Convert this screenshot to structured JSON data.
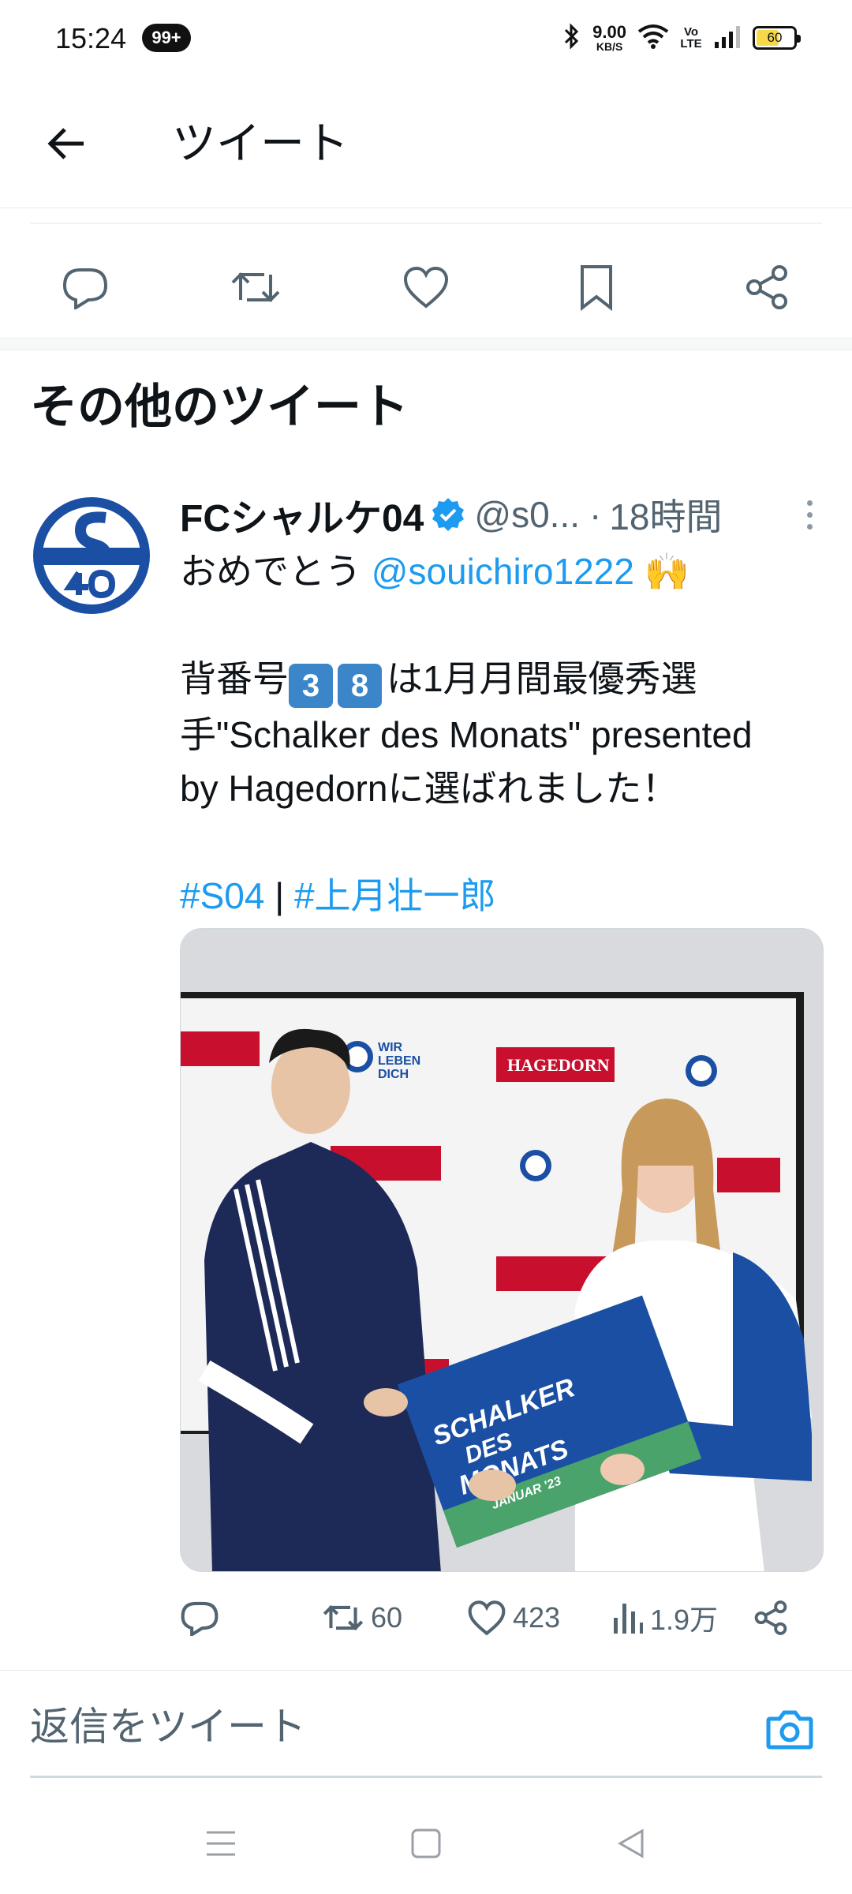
{
  "status_bar": {
    "time": "15:24",
    "notification_badge": "99+",
    "net_speed_value": "9.00",
    "net_speed_unit": "KB/S",
    "volte": "Vo LTE",
    "battery": "60",
    "battery_level": 0.6
  },
  "header": {
    "title": "ツイート"
  },
  "section": {
    "title": "その他のツイート"
  },
  "tweet": {
    "author": "FCシャルケ04",
    "handle": "@s0...",
    "separator": "·",
    "time": "18時間",
    "line1_prefix": "おめでとう ",
    "line1_mention": "@souichiro1222",
    "line1_emoji": "🙌",
    "line2_prefix": "背番号",
    "keycap1": "3",
    "keycap2": "8",
    "line2_suffix": "は1月月間最優秀選",
    "line3": "手\"Schalker des Monats\" presented",
    "line4": "by Hagedornに選ばれました！",
    "hashtag1": "#S04",
    "hashtag_sep": " | ",
    "hashtag2": "#上月壮一郎",
    "photo": {
      "banner_brand": "HAGEDORN",
      "banner_slogan_1": "WIR",
      "banner_slogan_2": "LEBEN",
      "banner_slogan_3": "DICH",
      "poster_line1": "SCHALKER",
      "poster_line2": "DES",
      "poster_line3": "MONATS",
      "poster_line4": "JANUAR '23"
    },
    "stats": {
      "retweets": "60",
      "likes": "423",
      "views": "1.9万"
    }
  },
  "reply": {
    "placeholder": "返信をツイート"
  },
  "colors": {
    "accent": "#1d9bf0",
    "schalke_blue": "#1a4fa3",
    "banner_red": "#c8102e"
  }
}
